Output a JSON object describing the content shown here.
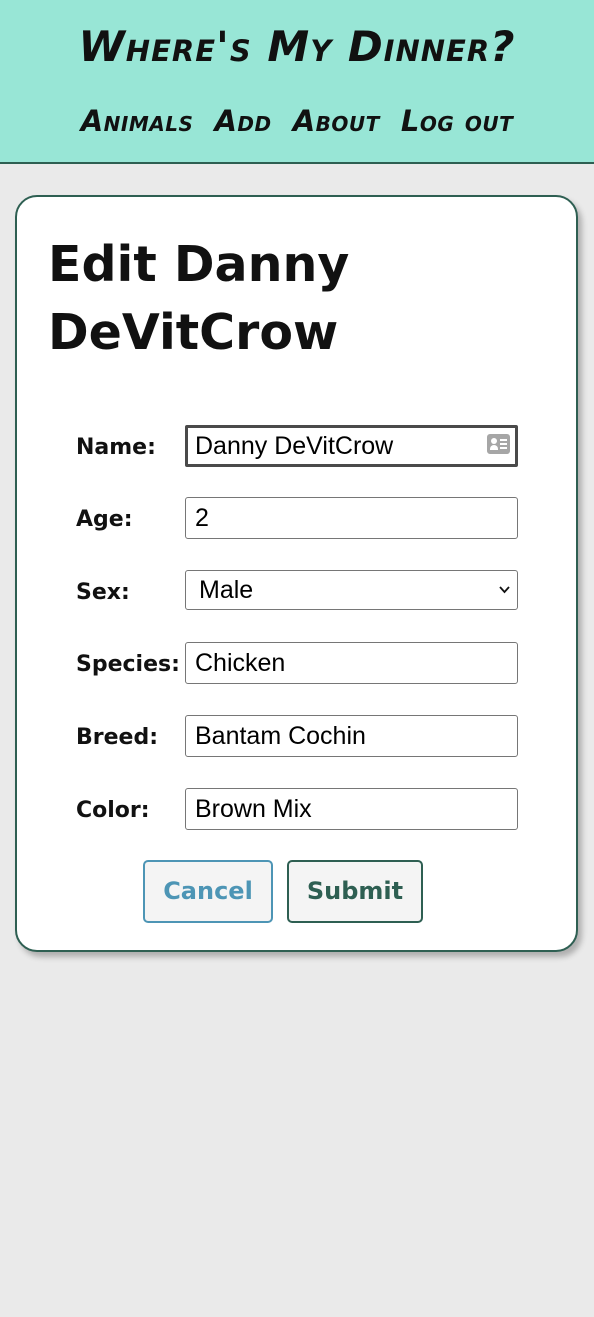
{
  "header": {
    "title": "Where's My Dinner?",
    "nav": [
      {
        "label": "Animals"
      },
      {
        "label": "Add"
      },
      {
        "label": "About"
      },
      {
        "label": "Log out"
      }
    ]
  },
  "card": {
    "heading": "Edit Danny DeVitCrow",
    "fields": {
      "name": {
        "label": "Name:",
        "value": "Danny DeVitCrow"
      },
      "age": {
        "label": "Age:",
        "value": "2"
      },
      "sex": {
        "label": "Sex:",
        "value": "Male"
      },
      "species": {
        "label": "Species:",
        "value": "Chicken"
      },
      "breed": {
        "label": "Breed:",
        "value": "Bantam Cochin"
      },
      "color": {
        "label": "Color:",
        "value": "Brown Mix"
      }
    },
    "buttons": {
      "cancel": "Cancel",
      "submit": "Submit"
    }
  },
  "colors": {
    "header_bg": "#98e6d6",
    "accent_dark": "#2e5f52",
    "cancel_accent": "#4d95b5",
    "page_bg": "#eaeaea"
  },
  "icons": {
    "name_field_autofill": "contact-card-icon",
    "sex_select": "chevron-down-icon"
  }
}
